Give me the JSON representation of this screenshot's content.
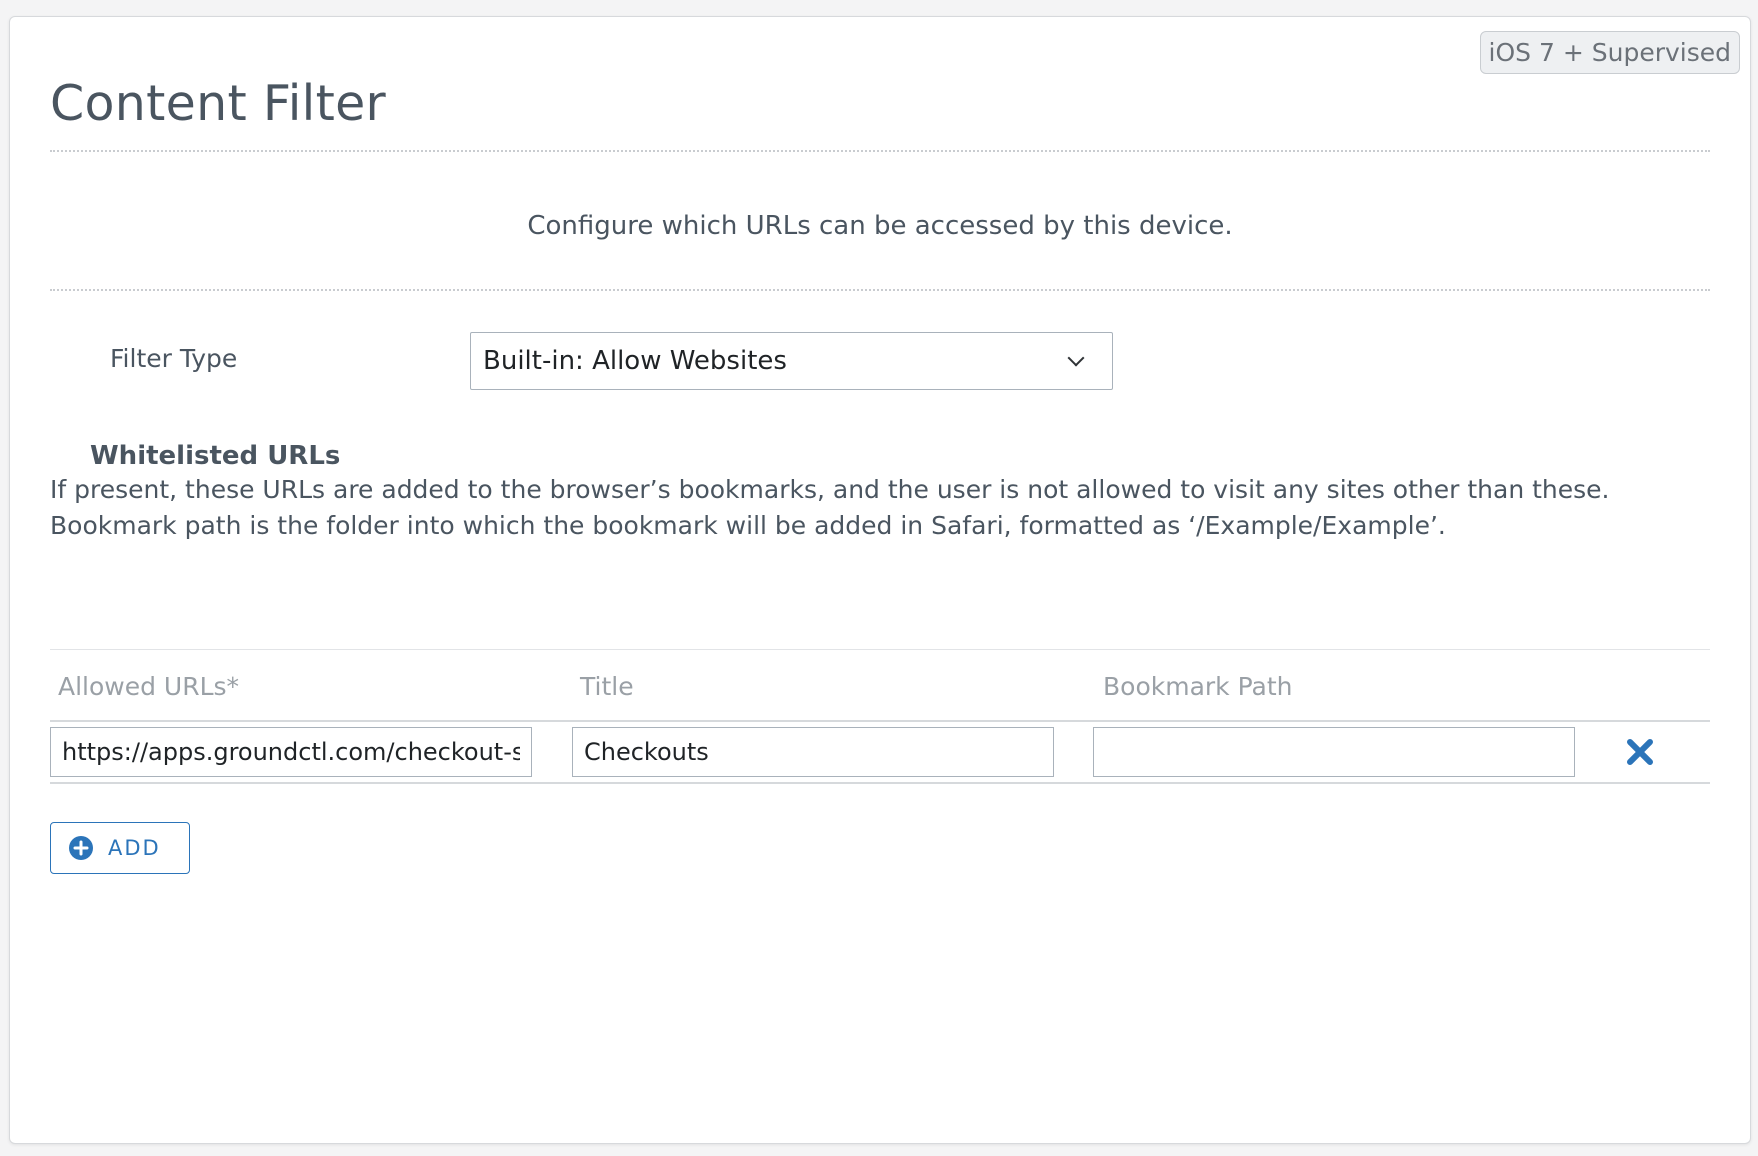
{
  "badge": "iOS 7 + Supervised",
  "page": {
    "title": "Content Filter",
    "intro": "Configure which URLs can be accessed by this device."
  },
  "filter_type": {
    "label": "Filter Type",
    "selected": "Built-in: Allow Websites"
  },
  "whitelist": {
    "heading": "Whitelisted URLs",
    "description": "If present, these URLs are added to the browser’s bookmarks, and the user is not allowed to visit any sites other than these. Bookmark path is the folder into which the bookmark will be added in Safari, formatted as ‘/Example/Example’.",
    "columns": {
      "url": "Allowed URLs*",
      "title": "Title",
      "path": "Bookmark Path"
    },
    "rows": [
      {
        "url": "https://apps.groundctl.com/checkout-s",
        "title": "Checkouts",
        "path": ""
      }
    ],
    "add_label": "ADD"
  },
  "icons": {
    "remove": "close-icon",
    "add": "plus-circle-icon",
    "select": "chevron-down-icon"
  },
  "colors": {
    "accent": "#2b74b9",
    "text": "#4a5560",
    "muted": "#9aa0a6"
  }
}
